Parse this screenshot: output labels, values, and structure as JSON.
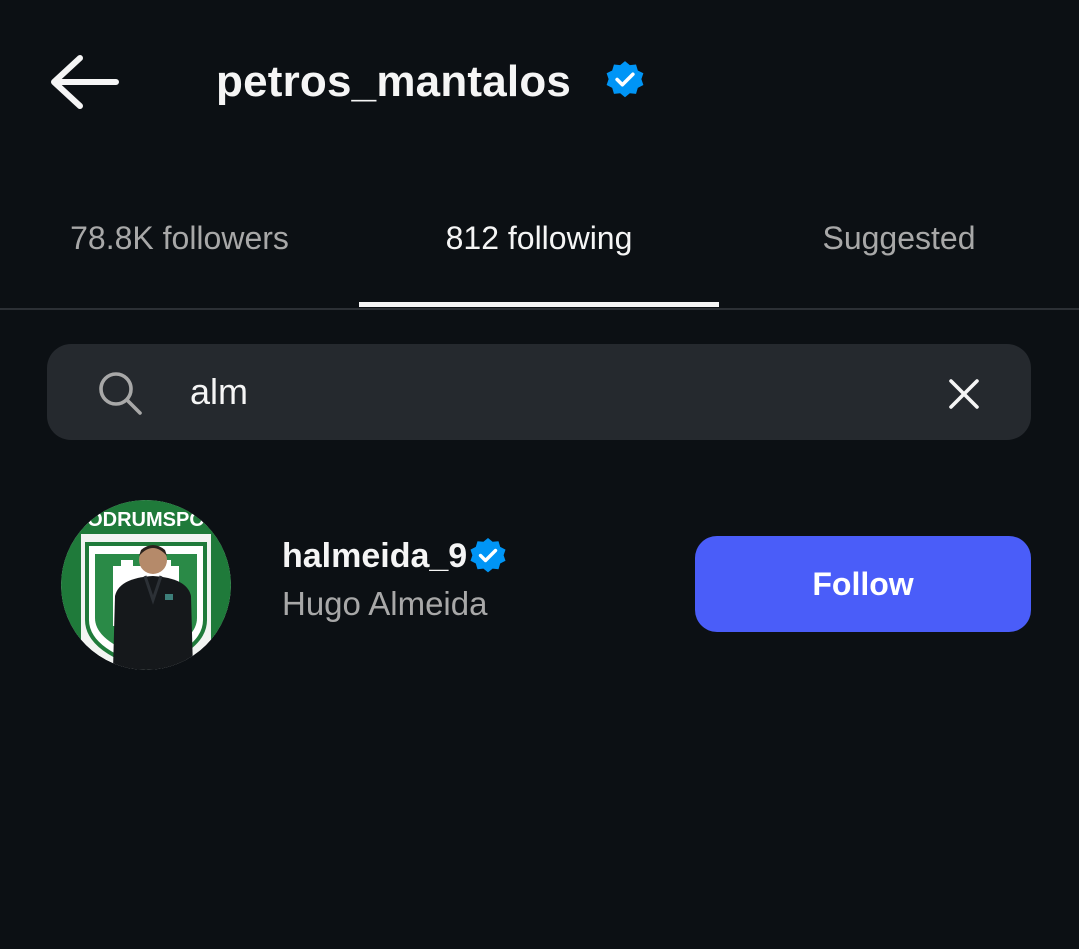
{
  "header": {
    "title": "petros_mantalos",
    "verified": true,
    "verified_color": "#0095f6",
    "back_icon": "arrow-left-icon"
  },
  "tabs": [
    {
      "label": "78.8K followers",
      "active": false
    },
    {
      "label": "812 following",
      "active": true
    },
    {
      "label": "Suggested",
      "active": false
    }
  ],
  "search": {
    "value": "alm",
    "search_icon": "search-icon",
    "clear_icon": "close-icon"
  },
  "results": [
    {
      "username": "halmeida_9",
      "full_name": "Hugo Almeida",
      "verified": true,
      "avatar_text": "ODRUMSPO",
      "follow_label": "Follow",
      "follow_color": "#4a5df9"
    }
  ]
}
